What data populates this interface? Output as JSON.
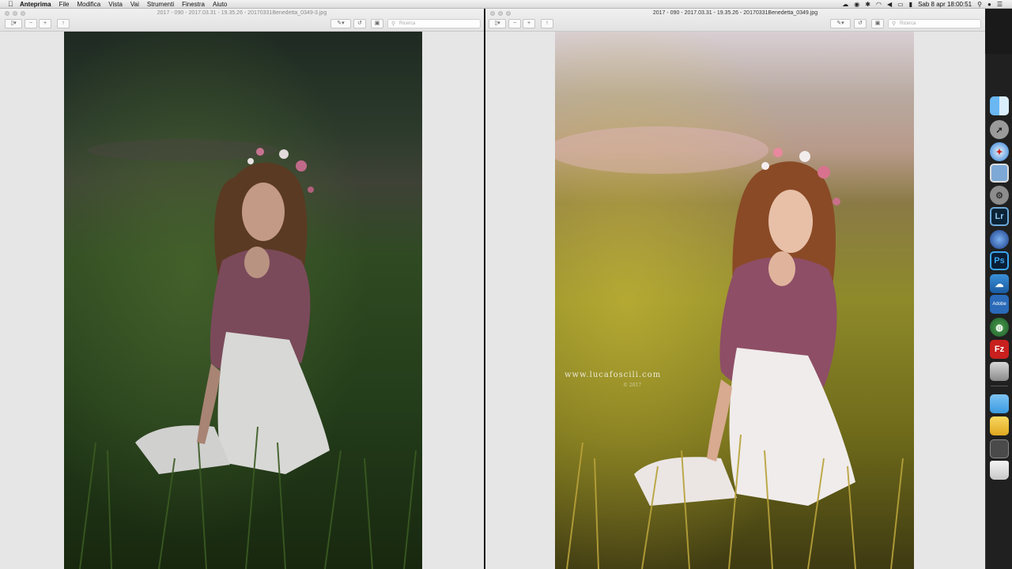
{
  "menubar": {
    "app_name": "Anteprima",
    "items": [
      "File",
      "Modifica",
      "Vista",
      "Vai",
      "Strumenti",
      "Finestra",
      "Aiuto"
    ],
    "datetime": "Sab 8 apr  18:00:51"
  },
  "left_window": {
    "title": "2017 - 090 - 2017.03.31 - 19.35.26 - 20170331Benedetta_0349-3.jpg",
    "search_placeholder": "Ricerca"
  },
  "right_window": {
    "title": "2017 - 090 - 2017.03.31 - 19.35.26 - 20170331Benedetta_0349.jpg",
    "search_placeholder": "Ricerca",
    "watermark": "www.lucafoscili.com",
    "watermark_year": "© 2017"
  },
  "dock": {
    "items": [
      {
        "name": "finder-icon",
        "label": ""
      },
      {
        "name": "launchpad-icon",
        "label": ""
      },
      {
        "name": "safari-icon",
        "label": ""
      },
      {
        "name": "preview-icon",
        "label": ""
      },
      {
        "name": "system-preferences-icon",
        "label": ""
      },
      {
        "name": "lightroom-icon",
        "label": "Lr"
      },
      {
        "name": "browser-icon",
        "label": ""
      },
      {
        "name": "photoshop-icon",
        "label": "Ps"
      },
      {
        "name": "creative-cloud-files-icon",
        "label": ""
      },
      {
        "name": "adobe-icon",
        "label": "Adobe"
      },
      {
        "name": "world-icon",
        "label": ""
      },
      {
        "name": "filezilla-icon",
        "label": "Fz"
      },
      {
        "name": "photos-folder-icon",
        "label": ""
      },
      {
        "name": "downloads-folder-icon",
        "label": ""
      },
      {
        "name": "drive-icon",
        "label": ""
      },
      {
        "name": "stack-icon",
        "label": ""
      },
      {
        "name": "trash-icon",
        "label": ""
      }
    ]
  }
}
